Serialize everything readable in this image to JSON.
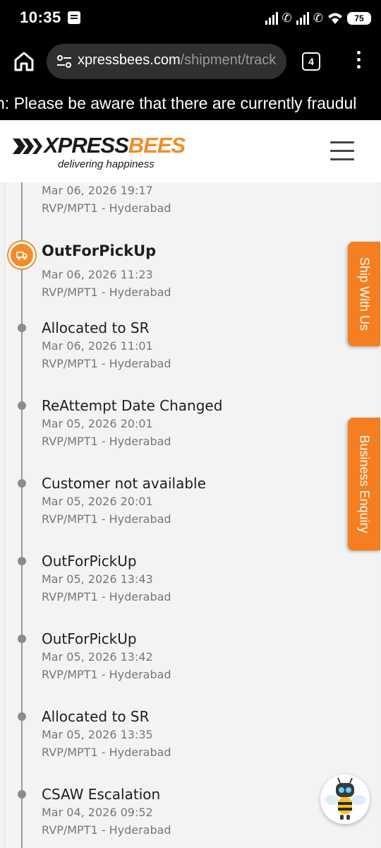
{
  "status_bar": {
    "time": "10:35",
    "battery": "75"
  },
  "browser": {
    "url_domain": "xpressbees.com",
    "url_path": "/shipment/track",
    "tab_count": "4"
  },
  "ticker": {
    "text": "n: Please be aware that there are currently fraudul"
  },
  "site": {
    "logo_xpress": "XPRESS",
    "logo_bees": "BEES",
    "logo_tagline": "delivering happiness",
    "brand_color": "#f28c28"
  },
  "side_tabs": {
    "ship_with_us": "Ship With Us",
    "business_enquiry": "Business Enquiry"
  },
  "timeline": [
    {
      "status": "",
      "date": "Mar 06, 2026 19:17",
      "location": "RVP/MPT1 - Hyderabad"
    },
    {
      "status": "OutForPickUp",
      "date": "Mar 06, 2026 11:23",
      "location": "RVP/MPT1 - Hyderabad",
      "active": true
    },
    {
      "status": "Allocated to SR",
      "date": "Mar 06, 2026 11:01",
      "location": "RVP/MPT1 - Hyderabad"
    },
    {
      "status": "ReAttempt Date Changed",
      "date": "Mar 05, 2026 20:01",
      "location": "RVP/MPT1 - Hyderabad"
    },
    {
      "status": "Customer not available",
      "date": "Mar 05, 2026 20:01",
      "location": "RVP/MPT1 - Hyderabad"
    },
    {
      "status": "OutForPickUp",
      "date": "Mar 05, 2026 13:43",
      "location": "RVP/MPT1 - Hyderabad"
    },
    {
      "status": "OutForPickUp",
      "date": "Mar 05, 2026 13:42",
      "location": "RVP/MPT1 - Hyderabad"
    },
    {
      "status": "Allocated to SR",
      "date": "Mar 05, 2026 13:35",
      "location": "RVP/MPT1 - Hyderabad"
    },
    {
      "status": "CSAW Escalation",
      "date": "Mar 04, 2026 09:52",
      "location": "RVP/MPT1 - Hyderabad"
    }
  ]
}
